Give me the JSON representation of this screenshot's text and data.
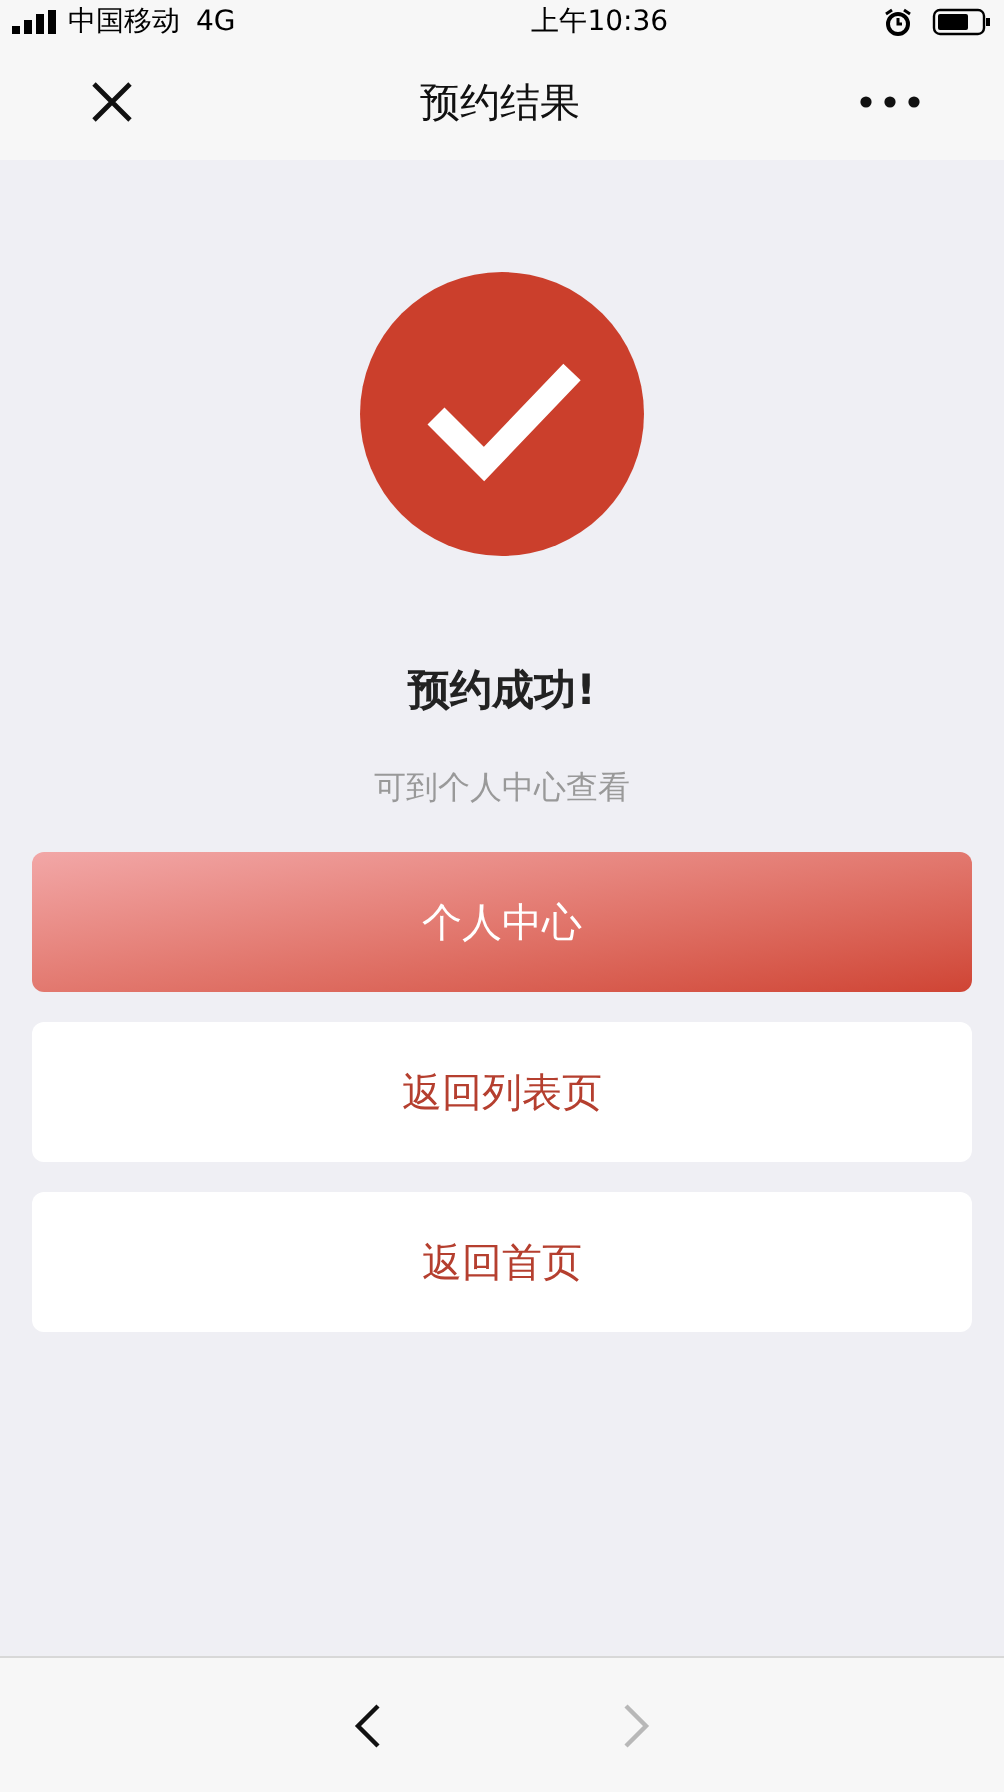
{
  "status_bar": {
    "carrier": "中国移动",
    "network": "4G",
    "time": "上午10:36"
  },
  "nav_bar": {
    "title": "预约结果"
  },
  "result": {
    "title": "预约成功!",
    "subtitle": "可到个人中心查看"
  },
  "buttons": [
    {
      "label": "个人中心",
      "kind": "primary"
    },
    {
      "label": "返回列表页",
      "kind": "secondary"
    },
    {
      "label": "返回首页",
      "kind": "secondary"
    }
  ],
  "toolbar": [
    {
      "kind": "back",
      "disabled": false
    },
    {
      "kind": "forward",
      "disabled": true
    }
  ]
}
